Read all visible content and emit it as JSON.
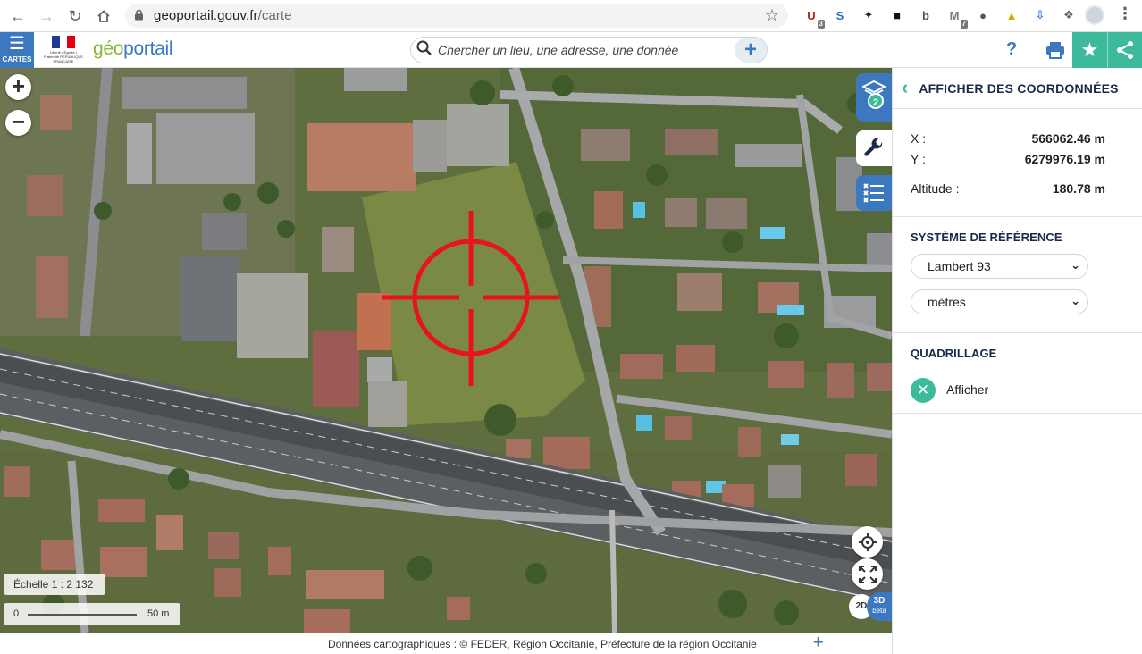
{
  "browser": {
    "url_host": "geoportail.gouv.fr",
    "url_path": "/carte",
    "extensions": [
      {
        "name": "ublock-icon",
        "badge": "3",
        "color": "#b42222"
      },
      {
        "name": "s-extension-icon",
        "badge": "",
        "color": "#2c6fc2"
      },
      {
        "name": "pin-extension-icon",
        "badge": "",
        "color": "#222"
      },
      {
        "name": "dark-extension-icon",
        "badge": "",
        "color": "#111"
      },
      {
        "name": "b-extension-icon",
        "badge": "",
        "color": "#555"
      },
      {
        "name": "gmail-extension-icon",
        "badge": "7",
        "color": "#777"
      },
      {
        "name": "circle-extension-icon",
        "badge": "",
        "color": "#555"
      },
      {
        "name": "flask-extension-icon",
        "badge": "",
        "color": "#d8a800"
      },
      {
        "name": "download-extension-icon",
        "badge": "",
        "color": "#2a7bd5"
      },
      {
        "name": "puzzle-extension-icon",
        "badge": "",
        "color": "#5f6368"
      }
    ]
  },
  "app": {
    "menu_label": "CARTES",
    "brand_geo": "géo",
    "brand_portail": "portail",
    "rf_caption": "Liberté • Égalité • Fraternité RÉPUBLIQUE FRANÇAISE",
    "search_placeholder": "Chercher un lieu, une adresse, une donnée",
    "help_label": "?"
  },
  "map": {
    "layers_count": "2",
    "scale_label": "Échelle 1 : 2 132",
    "scale_min": "0",
    "scale_max": "50 m",
    "mode_2d": "2D",
    "mode_3d": "3D",
    "mode_beta": "bêta",
    "crosshair_color": "#e8141b"
  },
  "footer": {
    "text": "Données cartographiques : ©   FEDER,  Région Occitanie,  Préfecture de la région Occitanie"
  },
  "panel": {
    "title": "AFFICHER DES COORDONNÉES",
    "x_label": "X :",
    "x_value": "566062.46  m",
    "y_label": "Y :",
    "y_value": "6279976.19  m",
    "alt_label": "Altitude :",
    "alt_value": "180.78  m",
    "ref_title": "SYSTÈME DE RÉFÉRENCE",
    "ref_system": "Lambert 93",
    "ref_unit": "mètres",
    "grid_title": "QUADRILLAGE",
    "grid_action": "Afficher"
  },
  "colors": {
    "primary": "#3b78c0",
    "accent": "#3cba9b"
  }
}
